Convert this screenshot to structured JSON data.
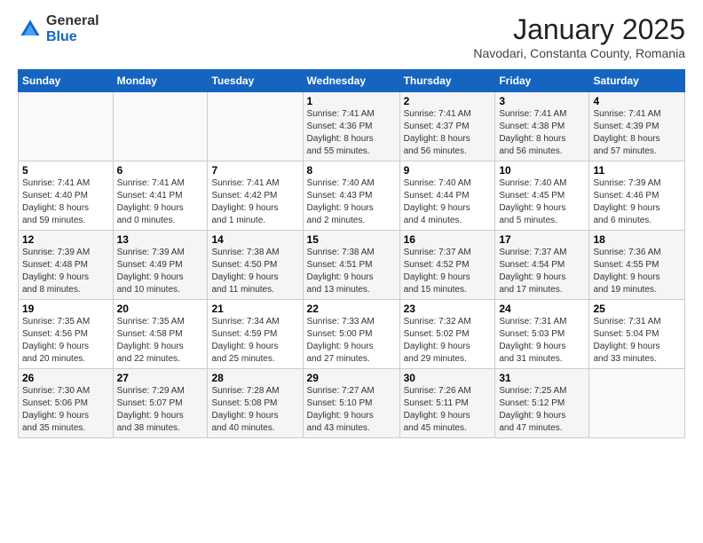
{
  "header": {
    "logo_general": "General",
    "logo_blue": "Blue",
    "month": "January 2025",
    "location": "Navodari, Constanta County, Romania"
  },
  "days_of_week": [
    "Sunday",
    "Monday",
    "Tuesday",
    "Wednesday",
    "Thursday",
    "Friday",
    "Saturday"
  ],
  "weeks": [
    [
      {
        "day": "",
        "info": ""
      },
      {
        "day": "",
        "info": ""
      },
      {
        "day": "",
        "info": ""
      },
      {
        "day": "1",
        "info": "Sunrise: 7:41 AM\nSunset: 4:36 PM\nDaylight: 8 hours\nand 55 minutes."
      },
      {
        "day": "2",
        "info": "Sunrise: 7:41 AM\nSunset: 4:37 PM\nDaylight: 8 hours\nand 56 minutes."
      },
      {
        "day": "3",
        "info": "Sunrise: 7:41 AM\nSunset: 4:38 PM\nDaylight: 8 hours\nand 56 minutes."
      },
      {
        "day": "4",
        "info": "Sunrise: 7:41 AM\nSunset: 4:39 PM\nDaylight: 8 hours\nand 57 minutes."
      }
    ],
    [
      {
        "day": "5",
        "info": "Sunrise: 7:41 AM\nSunset: 4:40 PM\nDaylight: 8 hours\nand 59 minutes."
      },
      {
        "day": "6",
        "info": "Sunrise: 7:41 AM\nSunset: 4:41 PM\nDaylight: 9 hours\nand 0 minutes."
      },
      {
        "day": "7",
        "info": "Sunrise: 7:41 AM\nSunset: 4:42 PM\nDaylight: 9 hours\nand 1 minute."
      },
      {
        "day": "8",
        "info": "Sunrise: 7:40 AM\nSunset: 4:43 PM\nDaylight: 9 hours\nand 2 minutes."
      },
      {
        "day": "9",
        "info": "Sunrise: 7:40 AM\nSunset: 4:44 PM\nDaylight: 9 hours\nand 4 minutes."
      },
      {
        "day": "10",
        "info": "Sunrise: 7:40 AM\nSunset: 4:45 PM\nDaylight: 9 hours\nand 5 minutes."
      },
      {
        "day": "11",
        "info": "Sunrise: 7:39 AM\nSunset: 4:46 PM\nDaylight: 9 hours\nand 6 minutes."
      }
    ],
    [
      {
        "day": "12",
        "info": "Sunrise: 7:39 AM\nSunset: 4:48 PM\nDaylight: 9 hours\nand 8 minutes."
      },
      {
        "day": "13",
        "info": "Sunrise: 7:39 AM\nSunset: 4:49 PM\nDaylight: 9 hours\nand 10 minutes."
      },
      {
        "day": "14",
        "info": "Sunrise: 7:38 AM\nSunset: 4:50 PM\nDaylight: 9 hours\nand 11 minutes."
      },
      {
        "day": "15",
        "info": "Sunrise: 7:38 AM\nSunset: 4:51 PM\nDaylight: 9 hours\nand 13 minutes."
      },
      {
        "day": "16",
        "info": "Sunrise: 7:37 AM\nSunset: 4:52 PM\nDaylight: 9 hours\nand 15 minutes."
      },
      {
        "day": "17",
        "info": "Sunrise: 7:37 AM\nSunset: 4:54 PM\nDaylight: 9 hours\nand 17 minutes."
      },
      {
        "day": "18",
        "info": "Sunrise: 7:36 AM\nSunset: 4:55 PM\nDaylight: 9 hours\nand 19 minutes."
      }
    ],
    [
      {
        "day": "19",
        "info": "Sunrise: 7:35 AM\nSunset: 4:56 PM\nDaylight: 9 hours\nand 20 minutes."
      },
      {
        "day": "20",
        "info": "Sunrise: 7:35 AM\nSunset: 4:58 PM\nDaylight: 9 hours\nand 22 minutes."
      },
      {
        "day": "21",
        "info": "Sunrise: 7:34 AM\nSunset: 4:59 PM\nDaylight: 9 hours\nand 25 minutes."
      },
      {
        "day": "22",
        "info": "Sunrise: 7:33 AM\nSunset: 5:00 PM\nDaylight: 9 hours\nand 27 minutes."
      },
      {
        "day": "23",
        "info": "Sunrise: 7:32 AM\nSunset: 5:02 PM\nDaylight: 9 hours\nand 29 minutes."
      },
      {
        "day": "24",
        "info": "Sunrise: 7:31 AM\nSunset: 5:03 PM\nDaylight: 9 hours\nand 31 minutes."
      },
      {
        "day": "25",
        "info": "Sunrise: 7:31 AM\nSunset: 5:04 PM\nDaylight: 9 hours\nand 33 minutes."
      }
    ],
    [
      {
        "day": "26",
        "info": "Sunrise: 7:30 AM\nSunset: 5:06 PM\nDaylight: 9 hours\nand 35 minutes."
      },
      {
        "day": "27",
        "info": "Sunrise: 7:29 AM\nSunset: 5:07 PM\nDaylight: 9 hours\nand 38 minutes."
      },
      {
        "day": "28",
        "info": "Sunrise: 7:28 AM\nSunset: 5:08 PM\nDaylight: 9 hours\nand 40 minutes."
      },
      {
        "day": "29",
        "info": "Sunrise: 7:27 AM\nSunset: 5:10 PM\nDaylight: 9 hours\nand 43 minutes."
      },
      {
        "day": "30",
        "info": "Sunrise: 7:26 AM\nSunset: 5:11 PM\nDaylight: 9 hours\nand 45 minutes."
      },
      {
        "day": "31",
        "info": "Sunrise: 7:25 AM\nSunset: 5:12 PM\nDaylight: 9 hours\nand 47 minutes."
      },
      {
        "day": "",
        "info": ""
      }
    ]
  ]
}
